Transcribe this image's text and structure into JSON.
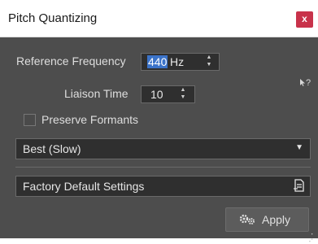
{
  "window": {
    "title": "Pitch Quantizing",
    "close_glyph": "x",
    "help_glyph": "?"
  },
  "form": {
    "reference_frequency": {
      "label": "Reference Frequency",
      "value": "440",
      "unit": "Hz"
    },
    "liaison_time": {
      "label": "Liaison Time",
      "value": "10"
    },
    "preserve_formants": {
      "label": "Preserve Formants",
      "checked": false
    },
    "quality": {
      "selected": "Best (Slow)"
    }
  },
  "presets": {
    "label": "Factory Default Settings"
  },
  "footer": {
    "apply_label": "Apply"
  },
  "colors": {
    "panel_bg": "#4d4d4d",
    "close_bg": "#c8324a",
    "selection": "#3b73c9"
  },
  "icons": [
    "close-icon",
    "help-cursor-icon",
    "spin-arrows-icon",
    "checkbox-icon",
    "dropdown-arrow-icon",
    "preset-save-icon",
    "settings-gears-icon",
    "resize-grip-icon"
  ]
}
